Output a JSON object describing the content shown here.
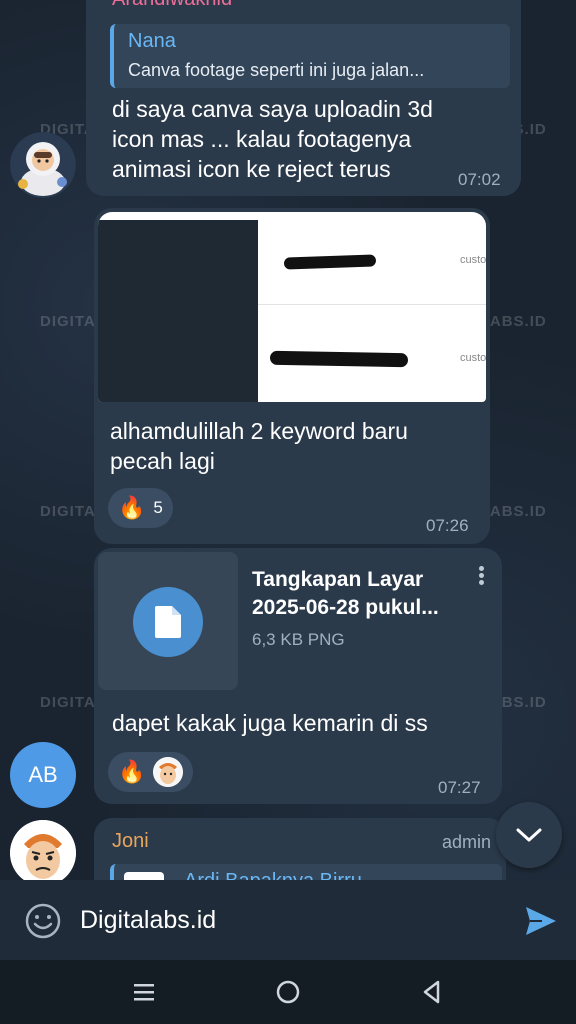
{
  "watermark": "DIGITALABS.ID",
  "message1": {
    "author": "Arandiwakhid",
    "reply": {
      "name": "Nana",
      "text": "Canva footage seperti ini juga jalan..."
    },
    "text_lines": [
      "di saya canva saya uploadin 3d",
      "icon mas ... kalau footagenya",
      "animasi icon ke reject terus"
    ],
    "time": "07:02"
  },
  "message2": {
    "image_labels": [
      "custo",
      "custo"
    ],
    "text_lines": [
      "alhamdulillah 2 keyword baru",
      "pecah lagi"
    ],
    "reaction": {
      "icon": "fire-emoji",
      "count": "5"
    },
    "time": "07:26"
  },
  "message3": {
    "file_name_lines": [
      "Tangkapan Layar",
      "2025-06-28 pukul..."
    ],
    "file_meta": "6,3 KB PNG",
    "text": "dapet kakak juga kemarin di ss",
    "reaction": {
      "icon": "fire-emoji"
    },
    "time": "07:27"
  },
  "avatar_initials": "AB",
  "message4": {
    "author": "Joni",
    "role": "admin",
    "reply_name": "Ardi Bapaknya Birru"
  },
  "composer": {
    "text": "Digitalabs.id"
  },
  "colors": {
    "accent": "#5aa8e8",
    "bubble": "#2b3a4b",
    "author_pink": "#ee6e9a",
    "author_orange": "#e9a65a"
  }
}
